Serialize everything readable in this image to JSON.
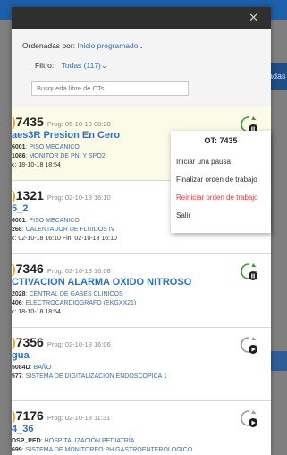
{
  "backdrop": {
    "tab_label": "Paradas"
  },
  "panel": {
    "sort_label": "Ordenadas por:",
    "sort_value": "Inicio programado",
    "filter_label": "Filtro:",
    "filter_value": "Todas (117)",
    "search_placeholder": "Busqueda libre de CTs"
  },
  "cards": [
    {
      "number": "7435",
      "prog": "Prog: 05-10-18 08:20",
      "title": "aes3R Presion En Cero",
      "line1_code": "6001",
      "line1_value": ": PISO MECANICO",
      "line2_code": "1086",
      "line2_value": ": MONITOR DE PNI Y SPO2",
      "line3": "c: 18-10-18 18:54"
    },
    {
      "number": "1321",
      "prog": "Prog: 02-10-18 16:10",
      "title": "5_2",
      "line1_code": "6001",
      "line1_value": ": PISO MECANICO",
      "line2_code": "268",
      "line2_value": ": CALENTADOR DE FLUIDOS IV",
      "line3": "c: 02-10-18 16:10 Fin: 02-10-18 16:10"
    },
    {
      "number": "7346",
      "prog": "Prog: 02-10-18 16:08",
      "title": "CTIVACION ALARMA OXIDO NITROSO",
      "line1_code": "2028",
      "line1_value": ": CENTRAL DE GASES CLINICOS",
      "line2_code": "406",
      "line2_value": ": ELECTROCARDIOGRAFO (EKGXX21)",
      "line3": "c: 18-10-18 18:54"
    },
    {
      "number": "7356",
      "prog": "Prog: 02-10-18 16:06",
      "title": "gua",
      "line1_code": "5084D",
      "line1_value": ": BAÑO",
      "line2_code": "577",
      "line2_value": ": SISTEMA DE DIGITALIZACION ENDOSCOPICA 1",
      "line3": ""
    },
    {
      "number": "7176",
      "prog": "Prog: 02-10-18 11:31",
      "title": "4_36",
      "line1_code": "DSP_PED",
      "line1_value": ": HOSPITALIZACIÓN PEDIATRÍA",
      "line2_code": "699",
      "line2_value": ": SISTEMA DE MONITOREO PH GASTROENTEROLOGICO",
      "line3": ""
    }
  ],
  "menu": {
    "title": "OT: 7435",
    "items": [
      {
        "label": "Iniciar una pausa"
      },
      {
        "label": "Finalizar orden de trabajo"
      },
      {
        "label": "Reiniciar orden de trabajo"
      },
      {
        "label": "Salir"
      }
    ]
  },
  "colors": {
    "accent": "#2d6fc4",
    "bullet": "#f0a020",
    "danger": "#e23a3a",
    "selected_bg": "#fcfbe8"
  }
}
